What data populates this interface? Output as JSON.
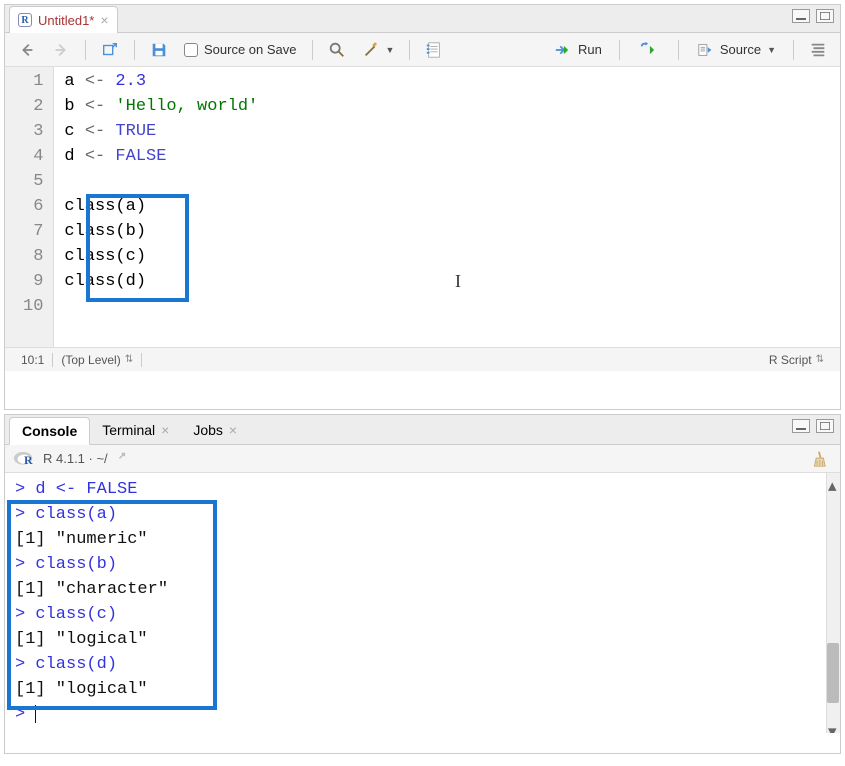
{
  "editor": {
    "tab": {
      "title": "Untitled1*",
      "icon_label": "R"
    },
    "toolbar": {
      "source_on_save": "Source on Save",
      "run": "Run",
      "source": "Source"
    },
    "lines": [
      {
        "n": 1,
        "var": "a",
        "op": "<-",
        "val": "2.3",
        "kind": "num"
      },
      {
        "n": 2,
        "var": "b",
        "op": "<-",
        "val": "'Hello, world'",
        "kind": "str"
      },
      {
        "n": 3,
        "var": "c",
        "op": "<-",
        "val": "TRUE",
        "kind": "kw"
      },
      {
        "n": 4,
        "var": "d",
        "op": "<-",
        "val": "FALSE",
        "kind": "kw"
      },
      {
        "n": 5,
        "text": ""
      },
      {
        "n": 6,
        "text": "class(a)"
      },
      {
        "n": 7,
        "text": "class(b)"
      },
      {
        "n": 8,
        "text": "class(c)"
      },
      {
        "n": 9,
        "text": "class(d)"
      },
      {
        "n": 10,
        "text": ""
      }
    ],
    "status": {
      "pos": "10:1",
      "scope": "(Top Level)",
      "type": "R Script"
    }
  },
  "console": {
    "tabs": {
      "console": "Console",
      "terminal": "Terminal",
      "jobs": "Jobs"
    },
    "header": {
      "version": "R 4.1.1 · ~/"
    },
    "lines": [
      {
        "kind": "prompt",
        "text": "d <- FALSE"
      },
      {
        "kind": "prompt",
        "text": "class(a)"
      },
      {
        "kind": "out",
        "text": "[1] \"numeric\""
      },
      {
        "kind": "prompt",
        "text": "class(b)"
      },
      {
        "kind": "out",
        "text": "[1] \"character\""
      },
      {
        "kind": "prompt",
        "text": "class(c)"
      },
      {
        "kind": "out",
        "text": "[1] \"logical\""
      },
      {
        "kind": "prompt",
        "text": "class(d)"
      },
      {
        "kind": "out",
        "text": "[1] \"logical\""
      },
      {
        "kind": "prompt",
        "text": ""
      }
    ]
  },
  "icons": {
    "back": "back",
    "forward": "forward",
    "popout": "popout",
    "save": "save",
    "search": "search",
    "wand": "wand",
    "notebook": "notebook",
    "run": "run",
    "rerun": "rerun",
    "source": "source",
    "outline": "outline",
    "broom": "broom"
  }
}
